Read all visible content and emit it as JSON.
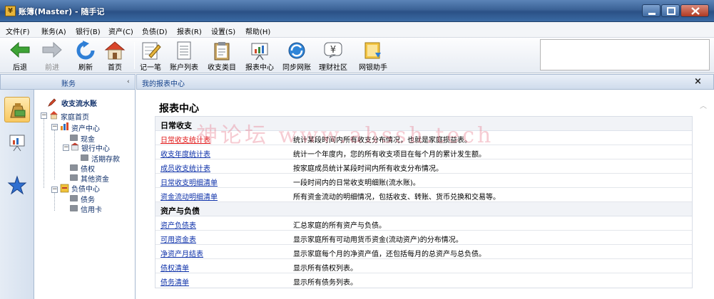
{
  "window": {
    "title": "账簿(Master) - 随手记"
  },
  "menu": [
    "文件(F)",
    "账务(A)",
    "银行(B)",
    "资产(C)",
    "负债(D)",
    "报表(R)",
    "设置(S)",
    "帮助(H)"
  ],
  "toolbar": {
    "back": "后退",
    "forward": "前进",
    "refresh": "刷新",
    "home": "首页",
    "record": "记一笔",
    "accounts": "账户列表",
    "categories": "收支类目",
    "reports": "报表中心",
    "sync": "同步网账",
    "community": "理财社区",
    "assistant": "网银助手"
  },
  "left": {
    "header": "账务",
    "collapse_glyph": "‹",
    "tree": {
      "title": "收支流水账",
      "home": "家庭首页",
      "assets": "资产中心",
      "cash": "现金",
      "bank": "银行中心",
      "deposit": "活期存款",
      "claim": "债权",
      "other": "其他资金",
      "liab": "负债中心",
      "debt": "债务",
      "credit": "信用卡"
    }
  },
  "tab": {
    "title": "我的报表中心",
    "close": "×"
  },
  "report": {
    "title": "报表中心",
    "sections": [
      {
        "name": "日常收支",
        "rows": [
          {
            "link": "日常收支统计表",
            "desc": "统计某段时间内所有收支分布情况，也就是家庭损益表。"
          },
          {
            "link": "收支年度统计表",
            "desc": "统计一个年度内，您的所有收支项目在每个月的累计发生额。"
          },
          {
            "link": "成员收支统计表",
            "desc": "按家庭成员统计某段时间内所有收支分布情况。"
          },
          {
            "link": "日常收支明细清单",
            "desc": "一段时间内的日常收支明细账(流水账)。"
          },
          {
            "link": "资金流动明细清单",
            "desc": "所有资金流动的明细情况，包括收支、转账、货币兑换和交易等。"
          }
        ]
      },
      {
        "name": "资产与负债",
        "rows": [
          {
            "link": "资产负债表",
            "desc": "汇总家庭的所有资产与负债。"
          },
          {
            "link": "可用资金表",
            "desc": "显示家庭所有可动用货币资金(流动资产)的分布情况。"
          },
          {
            "link": "净资产月结表",
            "desc": "显示家庭每个月的净资产值，还包括每月的总资产与总负债。"
          },
          {
            "link": "债权清单",
            "desc": "显示所有债权列表。"
          },
          {
            "link": "债务清单",
            "desc": "显示所有债务列表。"
          }
        ]
      }
    ]
  },
  "watermark": "神论坛   www.ahssh.tech",
  "colors": {
    "link": "#0b2fa8",
    "active_link": "#e01818",
    "header_text": "#15428b"
  }
}
